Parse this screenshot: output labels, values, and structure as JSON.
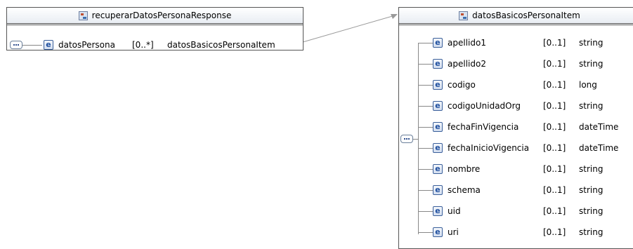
{
  "left_box": {
    "title": "recuperarDatosPersonaResponse",
    "element": {
      "name": "datosPersona",
      "multiplicity": "[0..*]",
      "type": "datosBasicosPersonaItem"
    }
  },
  "right_box": {
    "title": "datosBasicosPersonaItem",
    "elements": [
      {
        "name": "apellido1",
        "multiplicity": "[0..1]",
        "type": "string"
      },
      {
        "name": "apellido2",
        "multiplicity": "[0..1]",
        "type": "string"
      },
      {
        "name": "codigo",
        "multiplicity": "[0..1]",
        "type": "long"
      },
      {
        "name": "codigoUnidadOrg",
        "multiplicity": "[0..1]",
        "type": "string"
      },
      {
        "name": "fechaFinVigencia",
        "multiplicity": "[0..1]",
        "type": "dateTime"
      },
      {
        "name": "fechaInicioVigencia",
        "multiplicity": "[0..1]",
        "type": "dateTime"
      },
      {
        "name": "nombre",
        "multiplicity": "[0..1]",
        "type": "string"
      },
      {
        "name": "schema",
        "multiplicity": "[0..1]",
        "type": "string"
      },
      {
        "name": "uid",
        "multiplicity": "[0..1]",
        "type": "string"
      },
      {
        "name": "uri",
        "multiplicity": "[0..1]",
        "type": "string"
      }
    ]
  }
}
